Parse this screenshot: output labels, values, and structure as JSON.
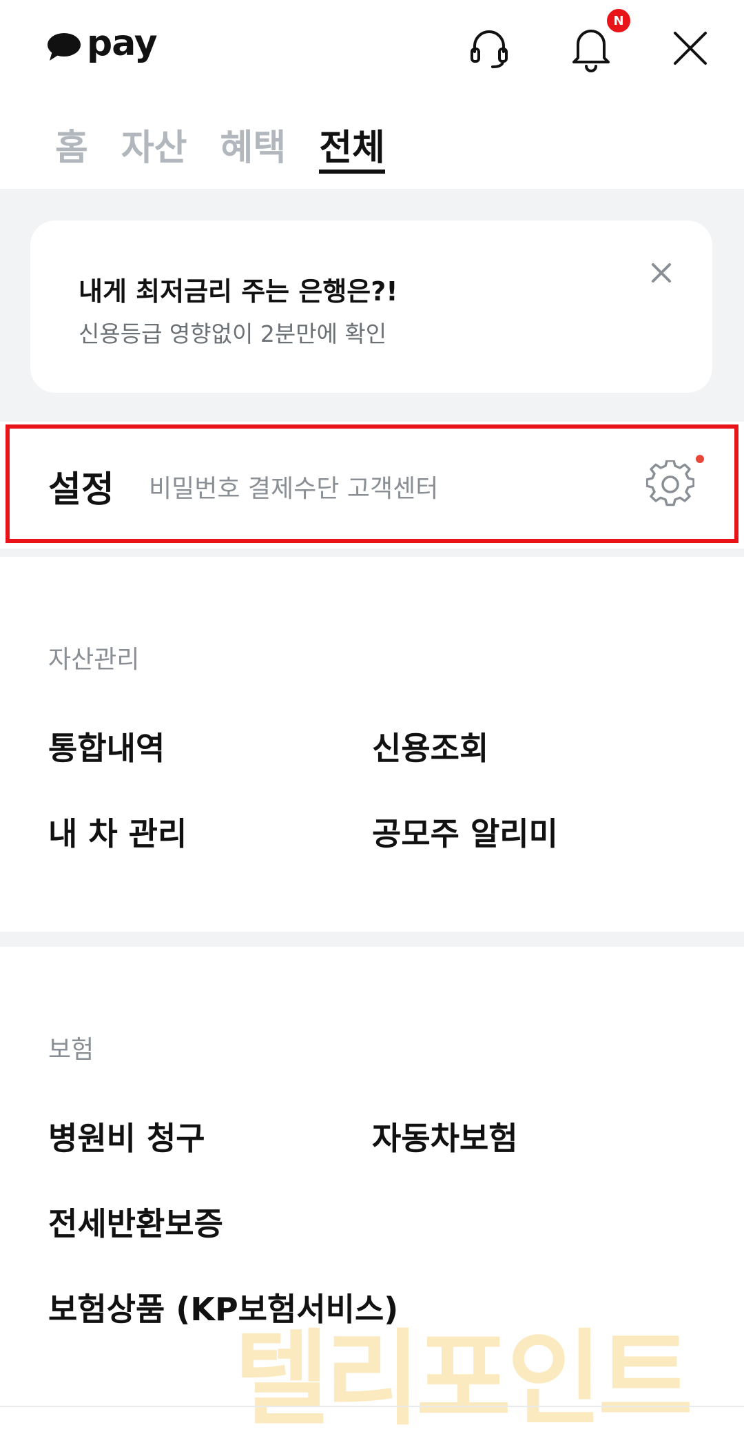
{
  "header": {
    "logo_text": "pay",
    "notification_badge": "N",
    "icons": [
      "headset-icon",
      "bell-icon",
      "close-icon"
    ]
  },
  "tabs": [
    {
      "label": "홈",
      "active": false
    },
    {
      "label": "자산",
      "active": false
    },
    {
      "label": "혜택",
      "active": false
    },
    {
      "label": "전체",
      "active": true
    }
  ],
  "promo": {
    "title": "내게 최저금리 주는 은행은?!",
    "subtitle": "신용등급 영향없이 2분만에 확인"
  },
  "settings": {
    "title": "설정",
    "subtitle": "비밀번호 결제수단 고객센터"
  },
  "sections": {
    "asset": {
      "label": "자산관리",
      "items": [
        "통합내역",
        "신용조회",
        "내 차 관리",
        "공모주 알리미"
      ]
    },
    "insurance": {
      "label": "보험",
      "items": [
        "병원비 청구",
        "자동차보험",
        "전세반환보증",
        "보험상품 (KP보험서비스)"
      ]
    }
  },
  "watermark": "텔리포인트",
  "colors": {
    "accent_red": "#e8141a",
    "tab_inactive": "#b2b7bd",
    "band_grey": "#f2f3f5",
    "watermark_yellow": "#f6c34a"
  }
}
